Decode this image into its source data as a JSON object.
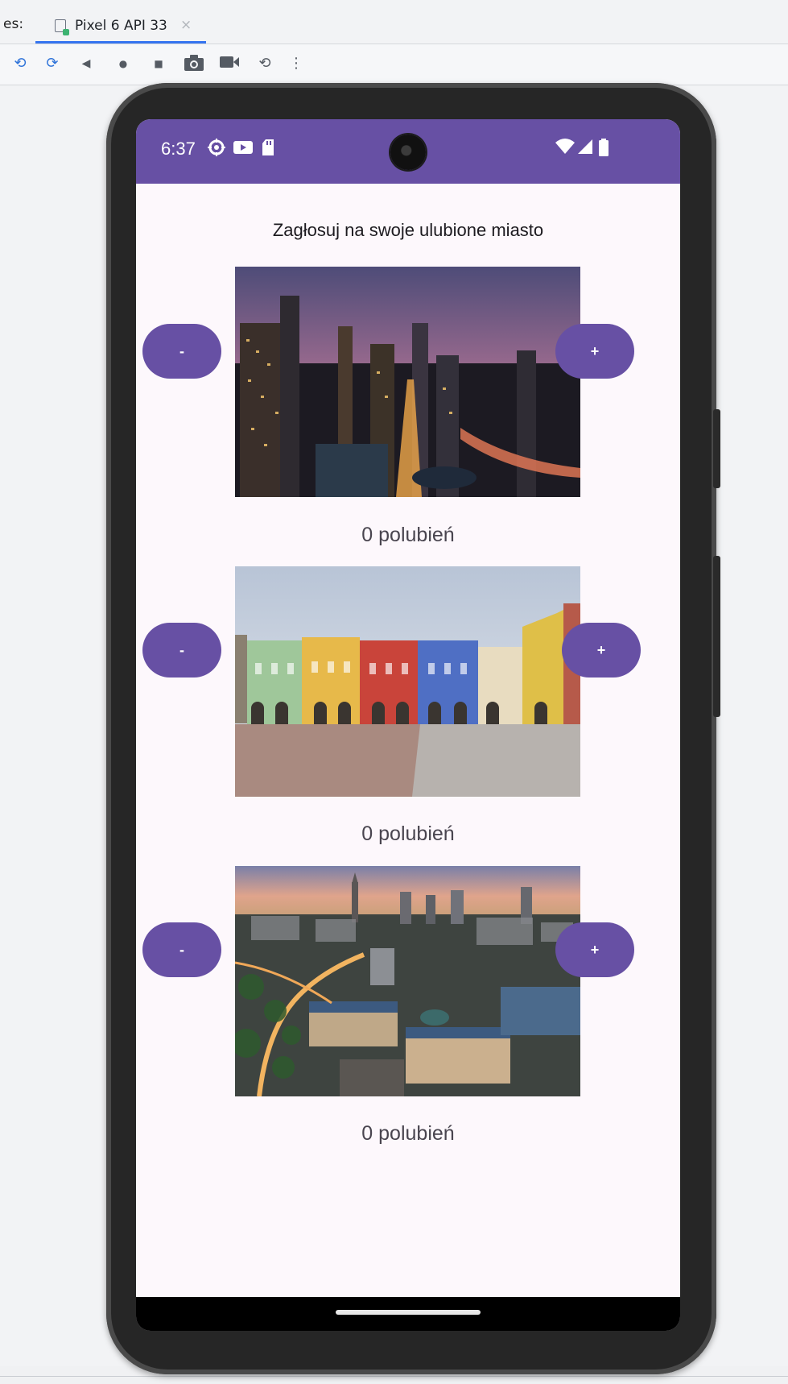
{
  "ide": {
    "tab_prefix": "es:",
    "tab_label": "Pixel 6 API 33",
    "tab_close": "×",
    "toolbar": [
      {
        "icon": "rotate-left-icon",
        "glyph": "⟲"
      },
      {
        "icon": "rotate-right-icon",
        "glyph": "⟳"
      },
      {
        "icon": "back-icon",
        "glyph": "◀"
      },
      {
        "icon": "home-icon",
        "glyph": "●"
      },
      {
        "icon": "overview-icon",
        "glyph": "■"
      },
      {
        "icon": "camera-icon",
        "glyph": "📷"
      },
      {
        "icon": "record-icon",
        "glyph": "■"
      },
      {
        "icon": "snapshot-icon",
        "glyph": "⟲"
      },
      {
        "icon": "more-icon",
        "glyph": "⋮"
      }
    ]
  },
  "device": {
    "status": {
      "time": "6:37",
      "left_icons": [
        "settings-icon",
        "youtube-icon",
        "sd-card-icon"
      ],
      "right_icons": [
        "wifi-icon",
        "signal-icon",
        "battery-icon"
      ]
    },
    "accent": "#6750a4"
  },
  "app": {
    "title": "Zagłosuj na swoje ulubione miasto",
    "cities": [
      {
        "image": "city-skyline-night",
        "minus_label": "-",
        "plus_label": "+",
        "likes_text": "0 polubień"
      },
      {
        "image": "old-town-square",
        "minus_label": "-",
        "plus_label": "+",
        "likes_text": "0 polubień"
      },
      {
        "image": "city-aerial-dusk",
        "minus_label": "-",
        "plus_label": "+",
        "likes_text": "0 polubień"
      }
    ]
  }
}
